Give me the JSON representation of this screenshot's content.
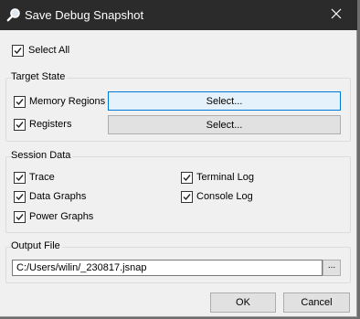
{
  "window": {
    "title": "Save Debug Snapshot",
    "title_icon": "magnifier-icon",
    "close_icon": "close-icon"
  },
  "select_all": {
    "label": "Select All",
    "checked": true
  },
  "target_state": {
    "title": "Target State",
    "items": [
      {
        "label": "Memory Regions",
        "checked": true,
        "button": "Select..."
      },
      {
        "label": "Registers",
        "checked": true,
        "button": "Select..."
      }
    ]
  },
  "session_data": {
    "title": "Session Data",
    "items": [
      {
        "label": "Trace",
        "checked": true
      },
      {
        "label": "Terminal Log",
        "checked": true
      },
      {
        "label": "Data Graphs",
        "checked": true
      },
      {
        "label": "Console Log",
        "checked": true
      },
      {
        "label": "Power Graphs",
        "checked": true
      }
    ]
  },
  "output_file": {
    "title": "Output File",
    "value": "C:/Users/wilin/_230817.jsnap",
    "browse_label": "..."
  },
  "buttons": {
    "ok": "OK",
    "cancel": "Cancel"
  },
  "colors": {
    "titlebar": "#2b2b2b",
    "dialog": "#f0f0f0",
    "focus": "#0078d7"
  }
}
